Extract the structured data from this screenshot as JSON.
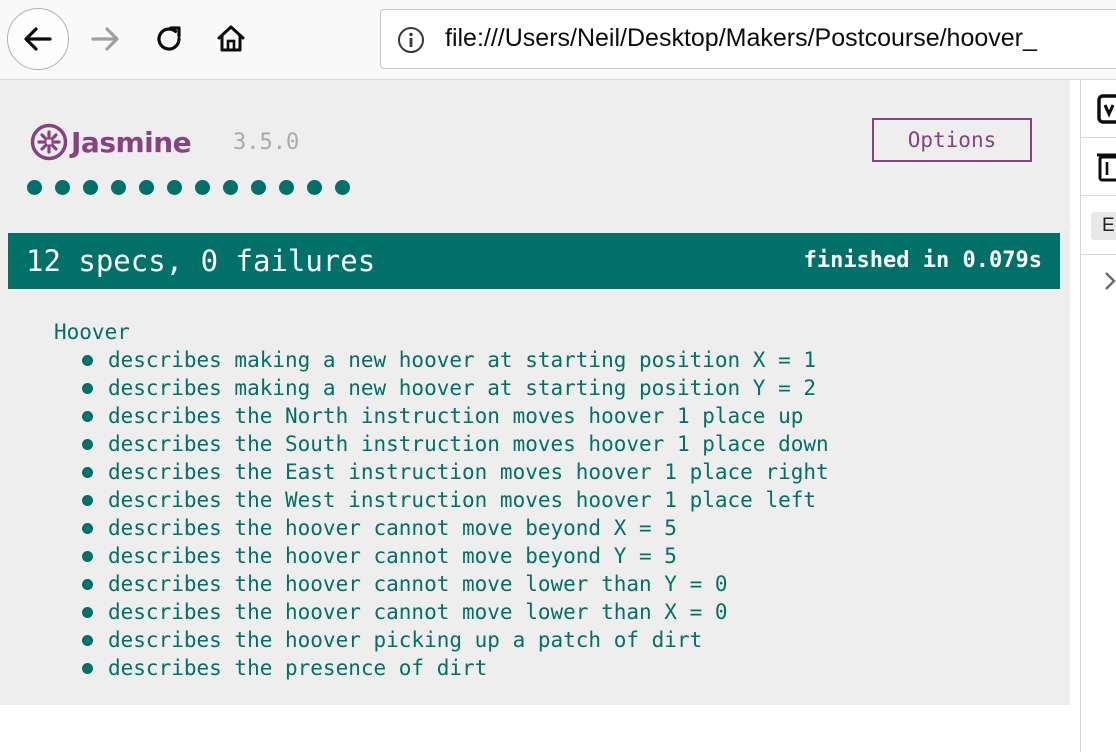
{
  "browser": {
    "url": "file:///Users/Neil/Desktop/Makers/Postcourse/hoover_",
    "icons": {
      "back": "back-arrow-icon",
      "forward": "forward-arrow-icon",
      "reload": "reload-icon",
      "home": "home-icon",
      "info": "info-icon"
    }
  },
  "jasmine": {
    "logo_text": "Jasmine",
    "version": "3.5.0",
    "options_label": "Options",
    "spec_dot_count": 12,
    "summary": "12 specs, 0 failures",
    "duration": "finished in 0.079s",
    "colors": {
      "passed": "#007069",
      "brand": "#8a4182",
      "background": "#eeeeee"
    },
    "suite": {
      "name": "Hoover",
      "specs": [
        "describes making a new hoover at starting position X = 1",
        "describes making a new hoover at starting position Y = 2",
        "describes the North instruction moves hoover 1 place up",
        "describes the South instruction moves hoover 1 place down",
        "describes the East instruction moves hoover 1 place right",
        "describes the West instruction moves hoover 1 place left",
        "describes the hoover cannot move beyond X = 5",
        "describes the hoover cannot move beyond Y = 5",
        "describes the hoover cannot move lower than Y = 0",
        "describes the hoover cannot move lower than X = 0",
        "describes the hoover picking up a patch of dirt",
        "describes the presence of dirt"
      ]
    }
  },
  "devtools": {
    "chip_label": "E",
    "icons": [
      "panel-icon",
      "trash-icon",
      "chevron-right-icon"
    ]
  }
}
